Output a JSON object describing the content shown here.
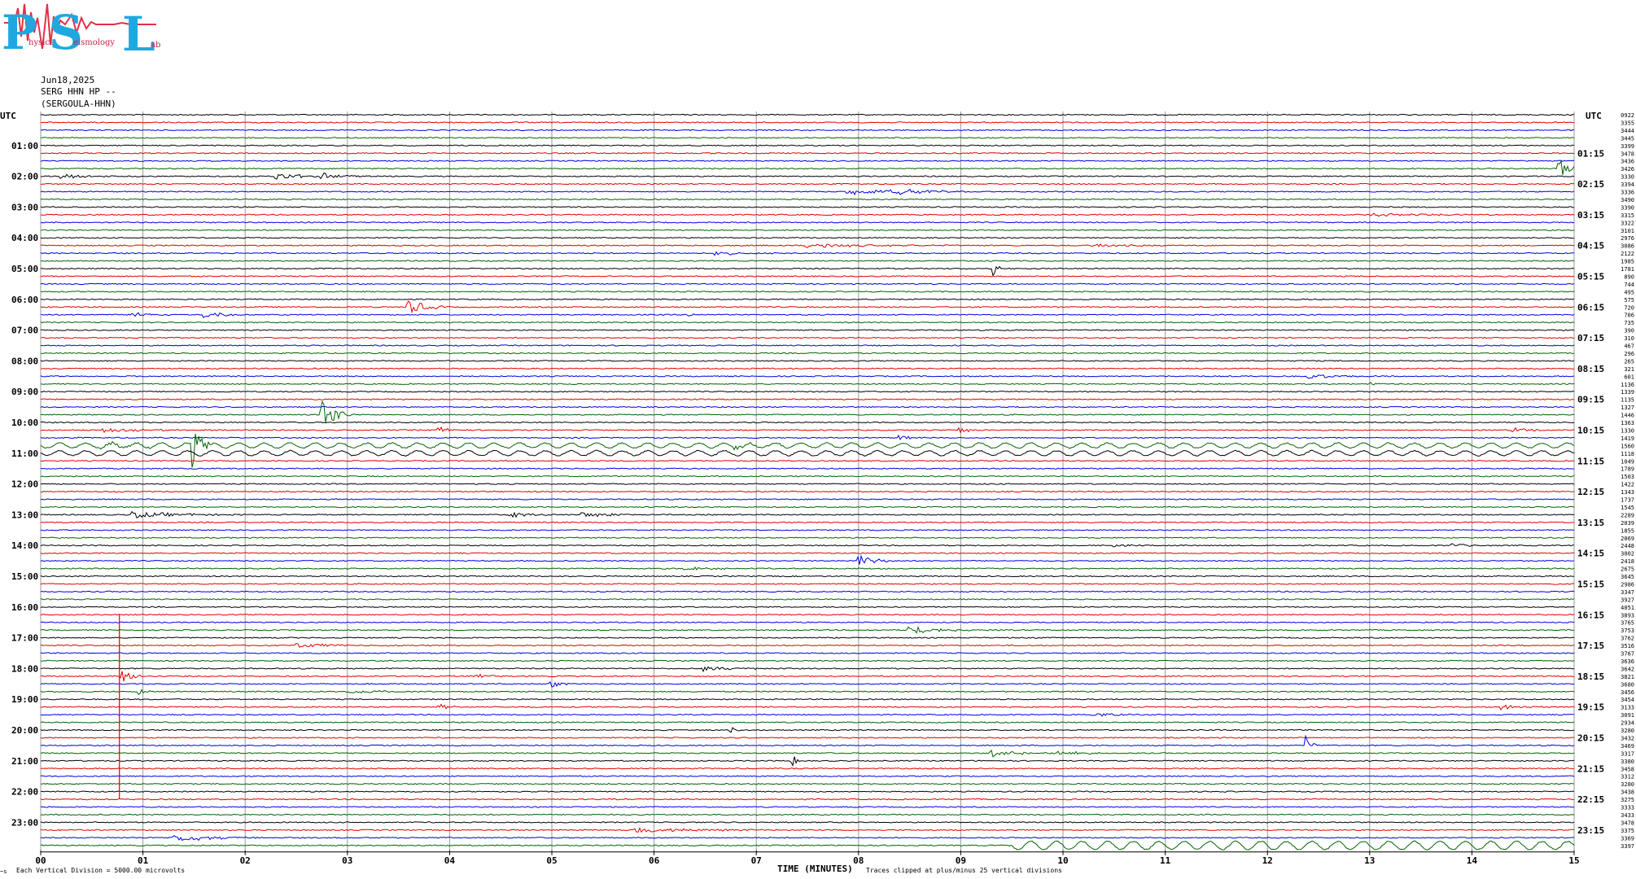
{
  "logo": {
    "letters": [
      "P",
      "S",
      "L"
    ],
    "words": [
      "hysics",
      "eismology",
      "ab"
    ],
    "color": "#1fa8e0",
    "wave_color": "#e0304a"
  },
  "header": {
    "date": "Jun18,2025",
    "station": "SERG HHN HP --",
    "location": "(SERGOULA-HHN)"
  },
  "chart_data": {
    "type": "line",
    "title": "",
    "xlabel": "TIME (MINUTES)",
    "x_ticks": [
      "00",
      "01",
      "02",
      "03",
      "04",
      "05",
      "06",
      "07",
      "08",
      "09",
      "10",
      "11",
      "12",
      "13",
      "14",
      "15"
    ],
    "xlim": [
      0,
      15
    ],
    "left_axis_label": "UTC",
    "right_axis_label": "UTC",
    "left_hour_labels": [
      "01:00",
      "02:00",
      "03:00",
      "04:00",
      "05:00",
      "06:00",
      "07:00",
      "08:00",
      "09:00",
      "10:00",
      "11:00",
      "12:00",
      "13:00",
      "14:00",
      "15:00",
      "16:00",
      "17:00",
      "18:00",
      "19:00",
      "20:00",
      "21:00",
      "22:00",
      "23:00"
    ],
    "right_hour_labels": [
      "01:15",
      "02:15",
      "03:15",
      "04:15",
      "05:15",
      "06:15",
      "07:15",
      "08:15",
      "09:15",
      "10:15",
      "11:15",
      "12:15",
      "13:15",
      "14:15",
      "15:15",
      "16:15",
      "17:15",
      "18:15",
      "19:15",
      "20:15",
      "21:15",
      "22:15",
      "23:15"
    ],
    "trace_colors": [
      "#000000",
      "#e00000",
      "#0000e0",
      "#006400"
    ],
    "trace_count": 96,
    "minutes_per_trace": 15,
    "trace_values": [
      "0922",
      "3355",
      "3444",
      "3445",
      "3399",
      "3478",
      "3436",
      "3426",
      "3330",
      "3394",
      "3336",
      "3490",
      "3390",
      "3315",
      "3322",
      "3101",
      "2976",
      "3086",
      "2122",
      "1985",
      "1781",
      "890",
      "744",
      "495",
      "575",
      "720",
      "706",
      "735",
      "390",
      "310",
      "467",
      "296",
      "265",
      "321",
      "601",
      "1136",
      "1339",
      "1135",
      "1327",
      "1446",
      "1363",
      "1330",
      "1419",
      "1560",
      "1118",
      "1049",
      "1789",
      "1503",
      "1422",
      "1343",
      "1737",
      "1545",
      "2289",
      "2039",
      "1855",
      "2069",
      "2448",
      "3002",
      "2418",
      "2675",
      "3645",
      "2986",
      "3347",
      "3927",
      "4051",
      "3893",
      "3765",
      "3753",
      "3762",
      "3516",
      "3767",
      "3636",
      "3642",
      "3821",
      "3680",
      "3456",
      "3454",
      "3133",
      "3091",
      "2934",
      "3280",
      "3432",
      "3469",
      "3317",
      "3380",
      "3458",
      "3312",
      "3280",
      "3438",
      "3275",
      "3333",
      "3433",
      "3478",
      "3375",
      "3369",
      "3397"
    ],
    "footer_left": "Each Vertical Division = 5000.00 microvolts",
    "footer_right": "Traces clipped at plus/minus 25 vertical divisions",
    "corner_mark": "~s",
    "events": [
      {
        "trace": 8,
        "t": 0.2,
        "amp": 4,
        "dur": 0.6
      },
      {
        "trace": 8,
        "t": 2.3,
        "amp": 5,
        "dur": 0.6
      },
      {
        "trace": 8,
        "t": 2.75,
        "amp": 4,
        "dur": 0.5
      },
      {
        "trace": 7,
        "t": 14.85,
        "amp": 12,
        "dur": 0.3
      },
      {
        "trace": 10,
        "t": 7.9,
        "amp": 4,
        "dur": 1.2
      },
      {
        "trace": 10,
        "t": 8.3,
        "amp": 4,
        "dur": 0.8
      },
      {
        "trace": 13,
        "t": 13.0,
        "amp": 2,
        "dur": 1.5
      },
      {
        "trace": 17,
        "t": 7.5,
        "amp": 3,
        "dur": 1.5
      },
      {
        "trace": 17,
        "t": 10.3,
        "amp": 2,
        "dur": 0.8
      },
      {
        "trace": 18,
        "t": 6.6,
        "amp": 3,
        "dur": 0.6
      },
      {
        "trace": 20,
        "t": 9.32,
        "amp": 9,
        "dur": 0.1
      },
      {
        "trace": 25,
        "t": 3.6,
        "amp": 10,
        "dur": 0.4
      },
      {
        "trace": 26,
        "t": 0.9,
        "amp": 4,
        "dur": 0.4
      },
      {
        "trace": 26,
        "t": 1.6,
        "amp": 4,
        "dur": 0.6
      },
      {
        "trace": 26,
        "t": 6.35,
        "amp": 3,
        "dur": 0.2
      },
      {
        "trace": 34,
        "t": 12.4,
        "amp": 3,
        "dur": 0.8
      },
      {
        "trace": 35,
        "t": 13.0,
        "amp": 3,
        "dur": 0.1
      },
      {
        "trace": 39,
        "t": 2.75,
        "amp": 22,
        "dur": 0.3
      },
      {
        "trace": 41,
        "t": 0.6,
        "amp": 3,
        "dur": 1.2
      },
      {
        "trace": 41,
        "t": 3.9,
        "amp": 4,
        "dur": 0.3
      },
      {
        "trace": 41,
        "t": 9.0,
        "amp": 4,
        "dur": 0.2
      },
      {
        "trace": 41,
        "t": 14.4,
        "amp": 3,
        "dur": 0.5
      },
      {
        "trace": 42,
        "t": 8.4,
        "amp": 4,
        "dur": 0.2
      },
      {
        "trace": 43,
        "t": 1.5,
        "amp": 28,
        "dur": 0.2
      },
      {
        "trace": 43,
        "t": 0.6,
        "amp": 3,
        "dur": 1.0
      },
      {
        "trace": 43,
        "t": 6.8,
        "amp": 3,
        "dur": 1.0
      },
      {
        "trace": 52,
        "t": 0.9,
        "amp": 4,
        "dur": 1.2
      },
      {
        "trace": 52,
        "t": 4.6,
        "amp": 3,
        "dur": 0.6
      },
      {
        "trace": 52,
        "t": 5.3,
        "amp": 3,
        "dur": 0.8
      },
      {
        "trace": 56,
        "t": 10.5,
        "amp": 2,
        "dur": 0.4
      },
      {
        "trace": 56,
        "t": 13.8,
        "amp": 3,
        "dur": 0.3
      },
      {
        "trace": 58,
        "t": 8.0,
        "amp": 8,
        "dur": 0.4
      },
      {
        "trace": 59,
        "t": 6.3,
        "amp": 2,
        "dur": 0.8
      },
      {
        "trace": 67,
        "t": 8.5,
        "amp": 5,
        "dur": 0.9
      },
      {
        "trace": 69,
        "t": 2.5,
        "amp": 3,
        "dur": 1.0
      },
      {
        "trace": 72,
        "t": 6.5,
        "amp": 3,
        "dur": 0.8
      },
      {
        "trace": 73,
        "t": 0.8,
        "amp": 9,
        "dur": 0.3
      },
      {
        "trace": 73,
        "t": 4.2,
        "amp": 3,
        "dur": 0.5
      },
      {
        "trace": 74,
        "t": 5.0,
        "amp": 5,
        "dur": 0.2
      },
      {
        "trace": 75,
        "t": 0.95,
        "amp": 4,
        "dur": 0.2
      },
      {
        "trace": 75,
        "t": 3.0,
        "amp": 3,
        "dur": 0.8
      },
      {
        "trace": 77,
        "t": 3.9,
        "amp": 4,
        "dur": 0.2
      },
      {
        "trace": 77,
        "t": 14.3,
        "amp": 4,
        "dur": 0.4
      },
      {
        "trace": 78,
        "t": 10.3,
        "amp": 3,
        "dur": 0.5
      },
      {
        "trace": 80,
        "t": 6.75,
        "amp": 4,
        "dur": 0.1
      },
      {
        "trace": 82,
        "t": 12.38,
        "amp": 10,
        "dur": 0.1
      },
      {
        "trace": 83,
        "t": 9.3,
        "amp": 5,
        "dur": 0.8
      },
      {
        "trace": 83,
        "t": 9.9,
        "amp": 5,
        "dur": 0.5
      },
      {
        "trace": 84,
        "t": 7.35,
        "amp": 8,
        "dur": 0.1
      },
      {
        "trace": 94,
        "t": 1.3,
        "amp": 5,
        "dur": 1.0
      },
      {
        "trace": 93,
        "t": 5.8,
        "amp": 3,
        "dur": 1.8
      }
    ],
    "spike": {
      "trace": 73,
      "t": 0.77,
      "top_trace": 65,
      "bottom_trace": 89,
      "color": "#e00000"
    },
    "wavy_traces": [
      {
        "trace": 43,
        "amp": 3,
        "period": 0.25
      },
      {
        "trace": 44,
        "amp": 3,
        "period": 0.25
      },
      {
        "trace": 95,
        "amp": 5,
        "period": 0.25,
        "from": 9.5
      }
    ]
  }
}
